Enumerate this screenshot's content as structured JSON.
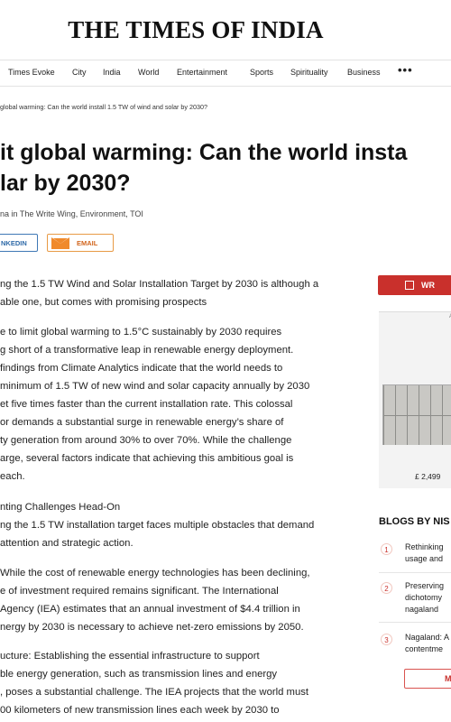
{
  "masthead": {
    "logo": "THE TIMES OF INDIA"
  },
  "nav": {
    "items": [
      "Times Evoke",
      "City",
      "India",
      "World",
      "Entertainment",
      "Sports",
      "Spirituality",
      "Business"
    ],
    "more": "•••"
  },
  "breadcrumb": "global warming: Can the world install 1.5 TW of wind and solar by 2030?",
  "headline": {
    "line1": "it global warming: Can the world insta",
    "line2": "lar by 2030?"
  },
  "byline": "na in The Write Wing, Environment, TOI",
  "share": {
    "linkedin": "NKEDIN",
    "email": "EMAIL"
  },
  "article": {
    "p1": [
      "ng the 1.5 TW Wind and Solar Installation Target by 2030 is although a",
      "able one, but comes with promising prospects"
    ],
    "p2": [
      "e to limit global warming to 1.5°C sustainably by 2030 requires",
      "g short of a transformative leap in renewable energy deployment.",
      "findings from Climate Analytics indicate that the world needs to",
      "minimum of 1.5 TW of new wind and solar capacity annually by 2030",
      "et five times faster than the current installation rate. This colossal",
      "or demands a substantial surge in renewable energy’s share of",
      "ty generation from around 30% to over 70%. While the challenge",
      "arge, several factors indicate that achieving this ambitious goal is",
      "each."
    ],
    "p3": [
      "nting Challenges Head-On",
      "ng the 1.5 TW installation target faces multiple obstacles that demand",
      "attention and strategic action."
    ],
    "p4": [
      "While the cost of renewable energy technologies has been declining,",
      "e of investment required remains significant. The International",
      "Agency (IEA) estimates that an annual investment of $4.4 trillion in",
      "nergy by 2030 is necessary to achieve net-zero emissions by 2050."
    ],
    "p5": [
      "ucture: Establishing the essential infrastructure to support",
      "ble energy generation, such as transmission lines and energy",
      ", poses a substantial challenge. The IEA projects that the world must",
      "00 kilometers of new transmission lines each week by 2030 to"
    ]
  },
  "sidebar": {
    "button_label": "WR",
    "ad": {
      "label": "A",
      "price": "£ 2,499"
    },
    "blogs_title": "BLOGS BY NIS",
    "blogs": [
      {
        "num": "1",
        "lines": [
          "Rethinking",
          "usage and"
        ]
      },
      {
        "num": "2",
        "lines": [
          "Preserving",
          "dichotomy",
          "nagaland"
        ]
      },
      {
        "num": "3",
        "lines": [
          "Nagaland: A",
          "contentme"
        ]
      }
    ],
    "more_label": "M"
  },
  "colors": {
    "accent": "#c9302c",
    "linkedin": "#2f6aa8",
    "email": "#f08a2c"
  }
}
